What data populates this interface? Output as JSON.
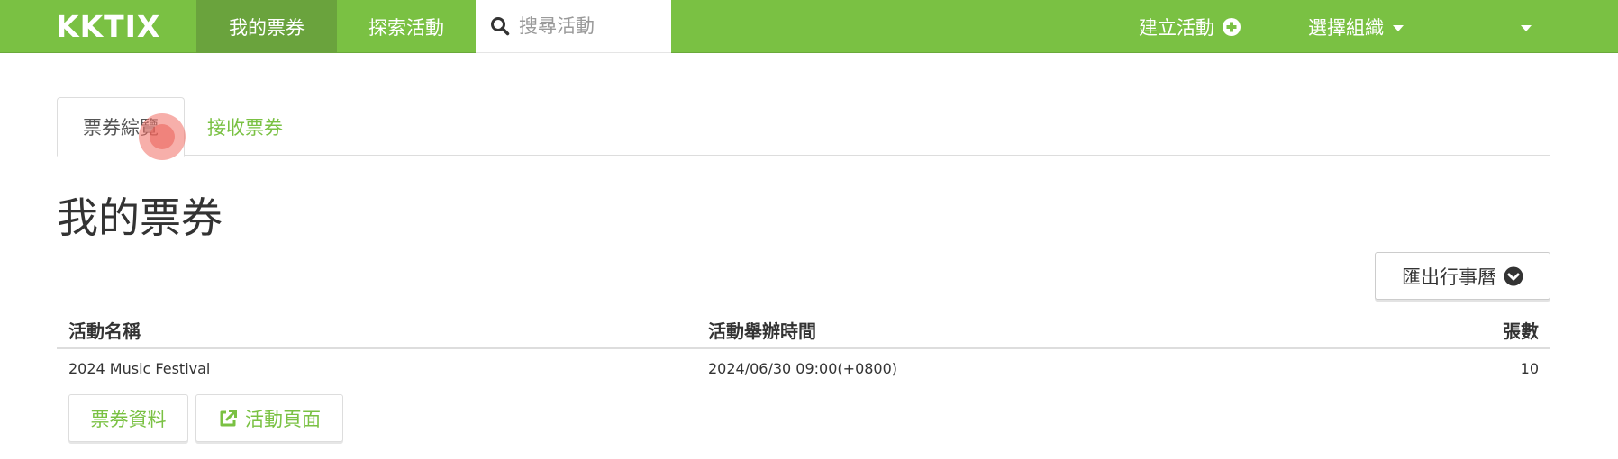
{
  "navbar": {
    "brand": "KKTIX",
    "my_tickets": "我的票券",
    "explore": "探索活動",
    "search_placeholder": "搜尋活動",
    "create_event": "建立活動",
    "select_org": "選擇組織",
    "accent_color": "#7ac143"
  },
  "tabs": [
    {
      "label": "票券綜覽",
      "active": true
    },
    {
      "label": "接收票券",
      "active": false
    }
  ],
  "page_title": "我的票券",
  "export_button": "匯出行事曆",
  "table": {
    "headers": {
      "name": "活動名稱",
      "time": "活動舉辦時間",
      "count": "張數"
    },
    "rows": [
      {
        "name": "2024 Music Festival",
        "time": "2024/06/30 09:00(+0800)",
        "count": "10",
        "actions": {
          "ticket_info": "票券資料",
          "event_page": "活動頁面"
        }
      }
    ]
  },
  "icons": {
    "search": "search-icon",
    "create": "plus-circle-icon",
    "export": "chevron-circle-down-icon",
    "external": "external-link-icon"
  }
}
